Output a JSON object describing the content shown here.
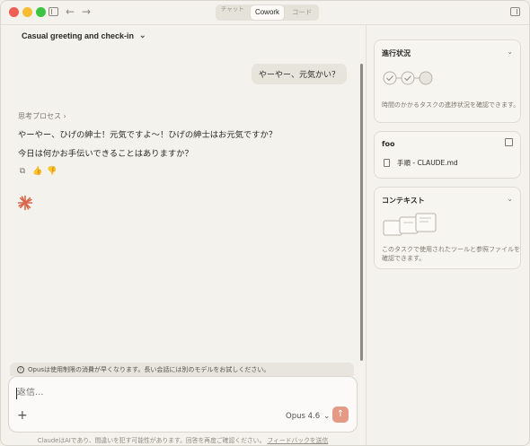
{
  "window": {
    "nav_back": "←",
    "nav_forward": "→",
    "tabs": [
      {
        "label": "チャット"
      },
      {
        "label": "Cowork"
      },
      {
        "label": "コード"
      }
    ]
  },
  "header": {
    "title": "Casual greeting and check-in",
    "chevron": "⌄"
  },
  "chat": {
    "user_message": "やーやー、元気かい？",
    "thought_label": "思考プロセス ›",
    "reply_line1": "やーやー、ひげの紳士！元気ですよ〜！ひげの紳士はお元気ですか？",
    "reply_line2": "今日は何かお手伝いできることはありますか？",
    "actions": {
      "copy": "⧉",
      "like": "👍",
      "dislike": "👎"
    }
  },
  "notice": {
    "icon": "i",
    "text": "Opusは使用制限の消費が早くなります。長い会話には別のモデルをお試しください。"
  },
  "composer": {
    "placeholder": "返信...",
    "plus": "+",
    "model": "Opus 4.6",
    "model_chevron": "⌄",
    "send": "↑"
  },
  "footer": {
    "text": "ClaudeはAIであり、間違いを犯す可能性があります。回答を再度ご確認ください。",
    "link": "フィードバックを送信"
  },
  "right_panel": {
    "progress": {
      "title": "進行状況",
      "chevron": "⌄",
      "description": "時間のかかるタスクの進捗状況を確認できます。"
    },
    "folder": {
      "title": "foo",
      "file": "手順 - CLAUDE.md"
    },
    "context": {
      "title": "コンテキスト",
      "chevron": "⌄",
      "description": "このタスクで使用されたツールと参照ファイルを確認できます。"
    }
  },
  "colors": {
    "accent": "#d9664a",
    "send_button": "#e59a86",
    "background": "#f4f2ec"
  }
}
